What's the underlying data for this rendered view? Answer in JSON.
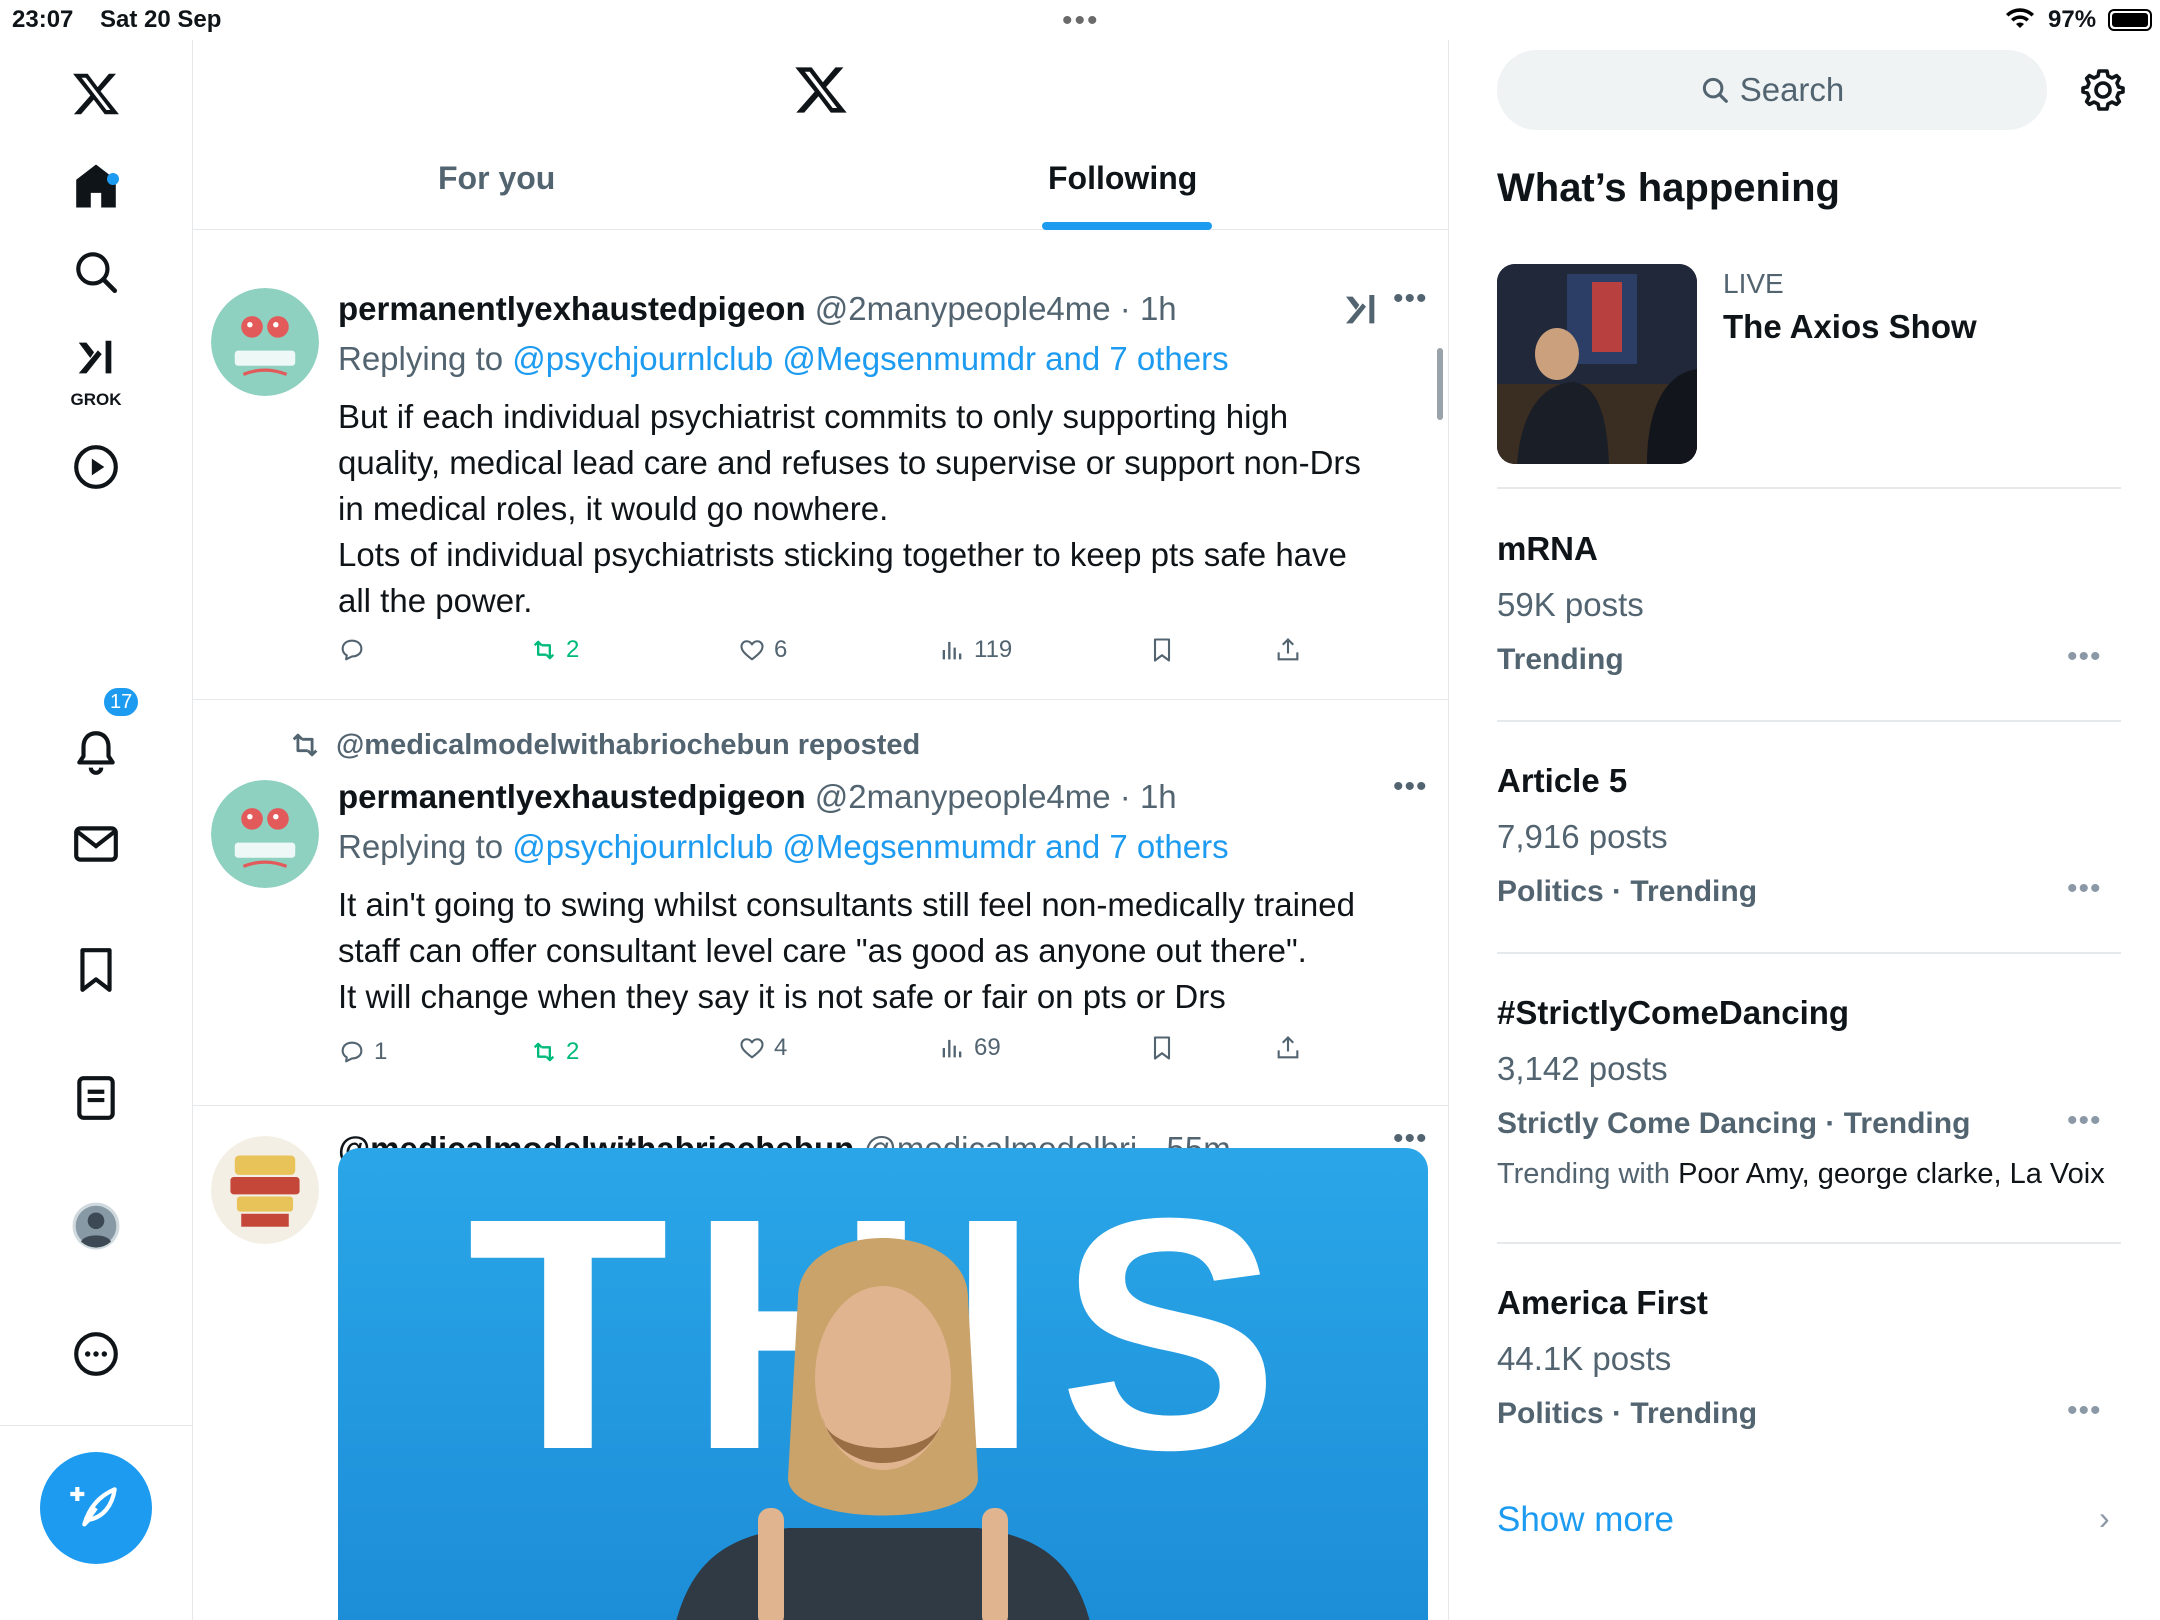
{
  "status_bar": {
    "time": "23:07",
    "date": "Sat 20 Sep",
    "battery": "97%"
  },
  "nav": {
    "grok_label": "GROK",
    "notifications_badge": "17"
  },
  "feed": {
    "tabs": {
      "for_you": "For you",
      "following": "Following"
    },
    "clipped_repost": "@medicalmodelwithabriochebun reposted",
    "tweets": [
      {
        "name": "permanentlyexhaustedpigeon",
        "handle_time": "@2manypeople4me · 1h",
        "replying_prefix": "Replying to ",
        "replying_links": "@psychjournlclub @Megsenmumdr and 7 others",
        "lines": [
          "But if each individual psychiatrist commits to only supporting high",
          "quality, medical lead care and refuses to supervise or support non-Drs",
          "in medical roles, it would go nowhere.",
          "Lots of individual psychiatrists sticking together to keep pts safe have",
          "all the power."
        ],
        "replies": "",
        "reposts": "2",
        "likes": "6",
        "views": "119"
      },
      {
        "repost_by": "@medicalmodelwithabriochebun reposted",
        "name": "permanentlyexhaustedpigeon",
        "handle_time": "@2manypeople4me · 1h",
        "replying_prefix": "Replying to ",
        "replying_links": "@psychjournlclub @Megsenmumdr and 7 others",
        "lines": [
          "It ain't going to swing whilst consultants still feel non-medically trained",
          "staff can offer consultant level care \"as good as anyone out there\".",
          "It will change when they say it is not safe or fair on pts or Drs"
        ],
        "replies": "1",
        "reposts": "2",
        "likes": "4",
        "views": "69"
      },
      {
        "name": "@medicalmodelwithabriochebun",
        "handle_time": "@medicalmodelbri · 55m",
        "media_text": "THIS"
      }
    ]
  },
  "sidebar": {
    "search_placeholder": "Search",
    "whats_happening": "What’s happening",
    "live": {
      "label": "LIVE",
      "title": "The Axios Show"
    },
    "trends": [
      {
        "name": "mRNA",
        "posts": "59K posts",
        "category": "Trending"
      },
      {
        "name": "Article 5",
        "posts": "7,916 posts",
        "category": "Politics · Trending"
      },
      {
        "name": "#StrictlyComeDancing",
        "posts": "3,142 posts",
        "category": "Strictly Come Dancing · Trending",
        "with_prefix": "Trending with ",
        "with_names": "Poor Amy, george clarke, La Voix"
      },
      {
        "name": "America First",
        "posts": "44.1K posts",
        "category": "Politics · Trending"
      }
    ],
    "show_more": "Show more"
  },
  "colors": {
    "accent": "#1d9bf0",
    "repost_green": "#00ba7c",
    "secondary_text": "#536471"
  }
}
